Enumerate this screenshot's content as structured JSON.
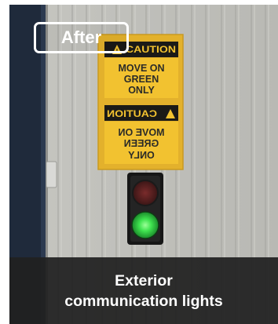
{
  "badge": {
    "label": "After"
  },
  "caption": {
    "line1": "Exterior",
    "line2": "communication lights"
  },
  "sign_top": {
    "header": "CAUTION",
    "lines": [
      "MOVE ON",
      "GREEN",
      "ONLY"
    ]
  },
  "sign_bottom": {
    "header": "CAUTION",
    "lines": [
      "MOVE ON",
      "GREEN",
      "ONLY"
    ],
    "mirrored": true
  },
  "traffic_light": {
    "red_lit": false,
    "green_lit": true
  },
  "colors": {
    "sign_yellow": "#f2c230",
    "sign_black": "#1b1a17",
    "wall": "#bdbdb8",
    "green_light": "#35e04a",
    "caption_bg": "#202020"
  }
}
